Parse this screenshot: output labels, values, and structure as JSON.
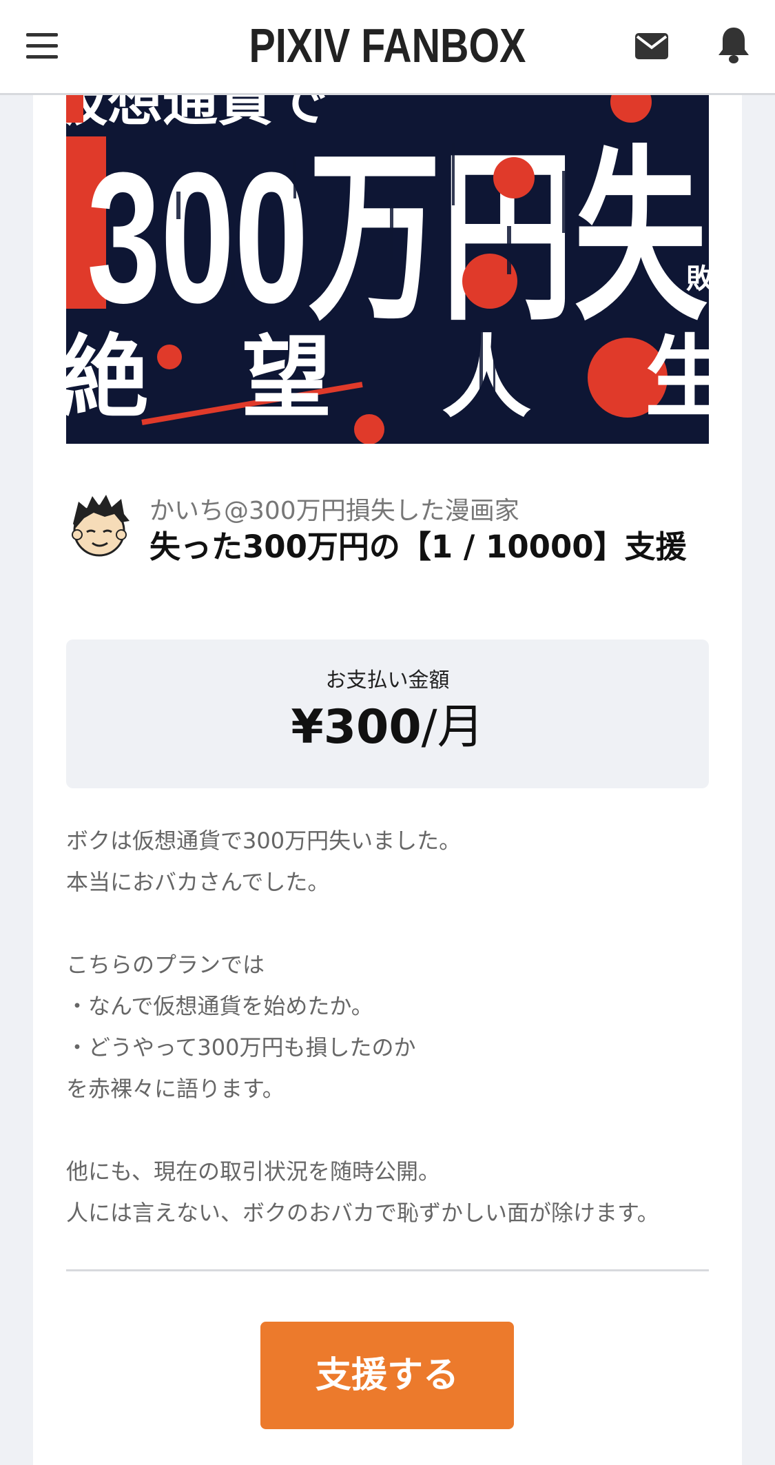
{
  "header": {
    "brand": "PIXIV FANBOX",
    "menu_icon": "hamburger-menu-icon",
    "mail_icon": "envelope-icon",
    "notification_icon": "bell-icon"
  },
  "banner": {
    "top_text": "仮想通貨で",
    "main_text": "300万円失",
    "side_text": "敗の",
    "bottom_words": [
      "絶",
      "望",
      "人",
      "生"
    ]
  },
  "creator": {
    "name": "かいち@300万円損失した漫画家",
    "plan_title": "失った300万円の【1 / 10000】支援"
  },
  "price": {
    "label": "お支払い金額",
    "amount": "¥300",
    "unit": "/月"
  },
  "description": {
    "lines": [
      "ボクは仮想通貨で300万円失いました。",
      "本当におバカさんでした。",
      "",
      "こちらのプランでは",
      "・なんで仮想通貨を始めたか。",
      "・どうやって300万円も損したのか",
      "を赤裸々に語ります。",
      "",
      "他にも、現在の取引状況を随時公開。",
      "人には言えない、ボクのおバカで恥ずかしい面が除けます。"
    ]
  },
  "actions": {
    "support_label": "支援する"
  },
  "colors": {
    "accent": "#ec7a2c",
    "banner_bg": "#0e1634",
    "banner_red": "#e03a2a",
    "page_bg": "#eff1f5"
  }
}
